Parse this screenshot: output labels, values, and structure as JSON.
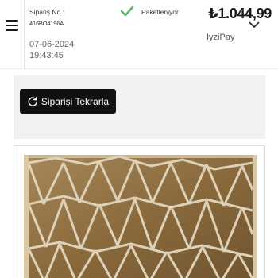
{
  "order": {
    "label": "Sipariş No :",
    "id": "416BO4196A",
    "date": "07-06-2024",
    "time": "19:43:45",
    "status": "Paketleniyor",
    "price": "₺1.044,99",
    "payment_method": "IyziPay"
  },
  "actions": {
    "reorder_label": "Siparişi Tekrarla"
  },
  "product": {
    "image_alt": ""
  },
  "colors": {
    "status_check": "#5cb85c",
    "button_bg": "#111111",
    "panel_bg": "#f1f1f1",
    "image_frame": "#c9b48a",
    "image_tile": "#8a6a3c"
  },
  "icons": {
    "menu": "hamburger-menu-icon",
    "status": "checkmark-icon",
    "expand": "chevron-down-icon",
    "reorder": "refresh-icon"
  }
}
